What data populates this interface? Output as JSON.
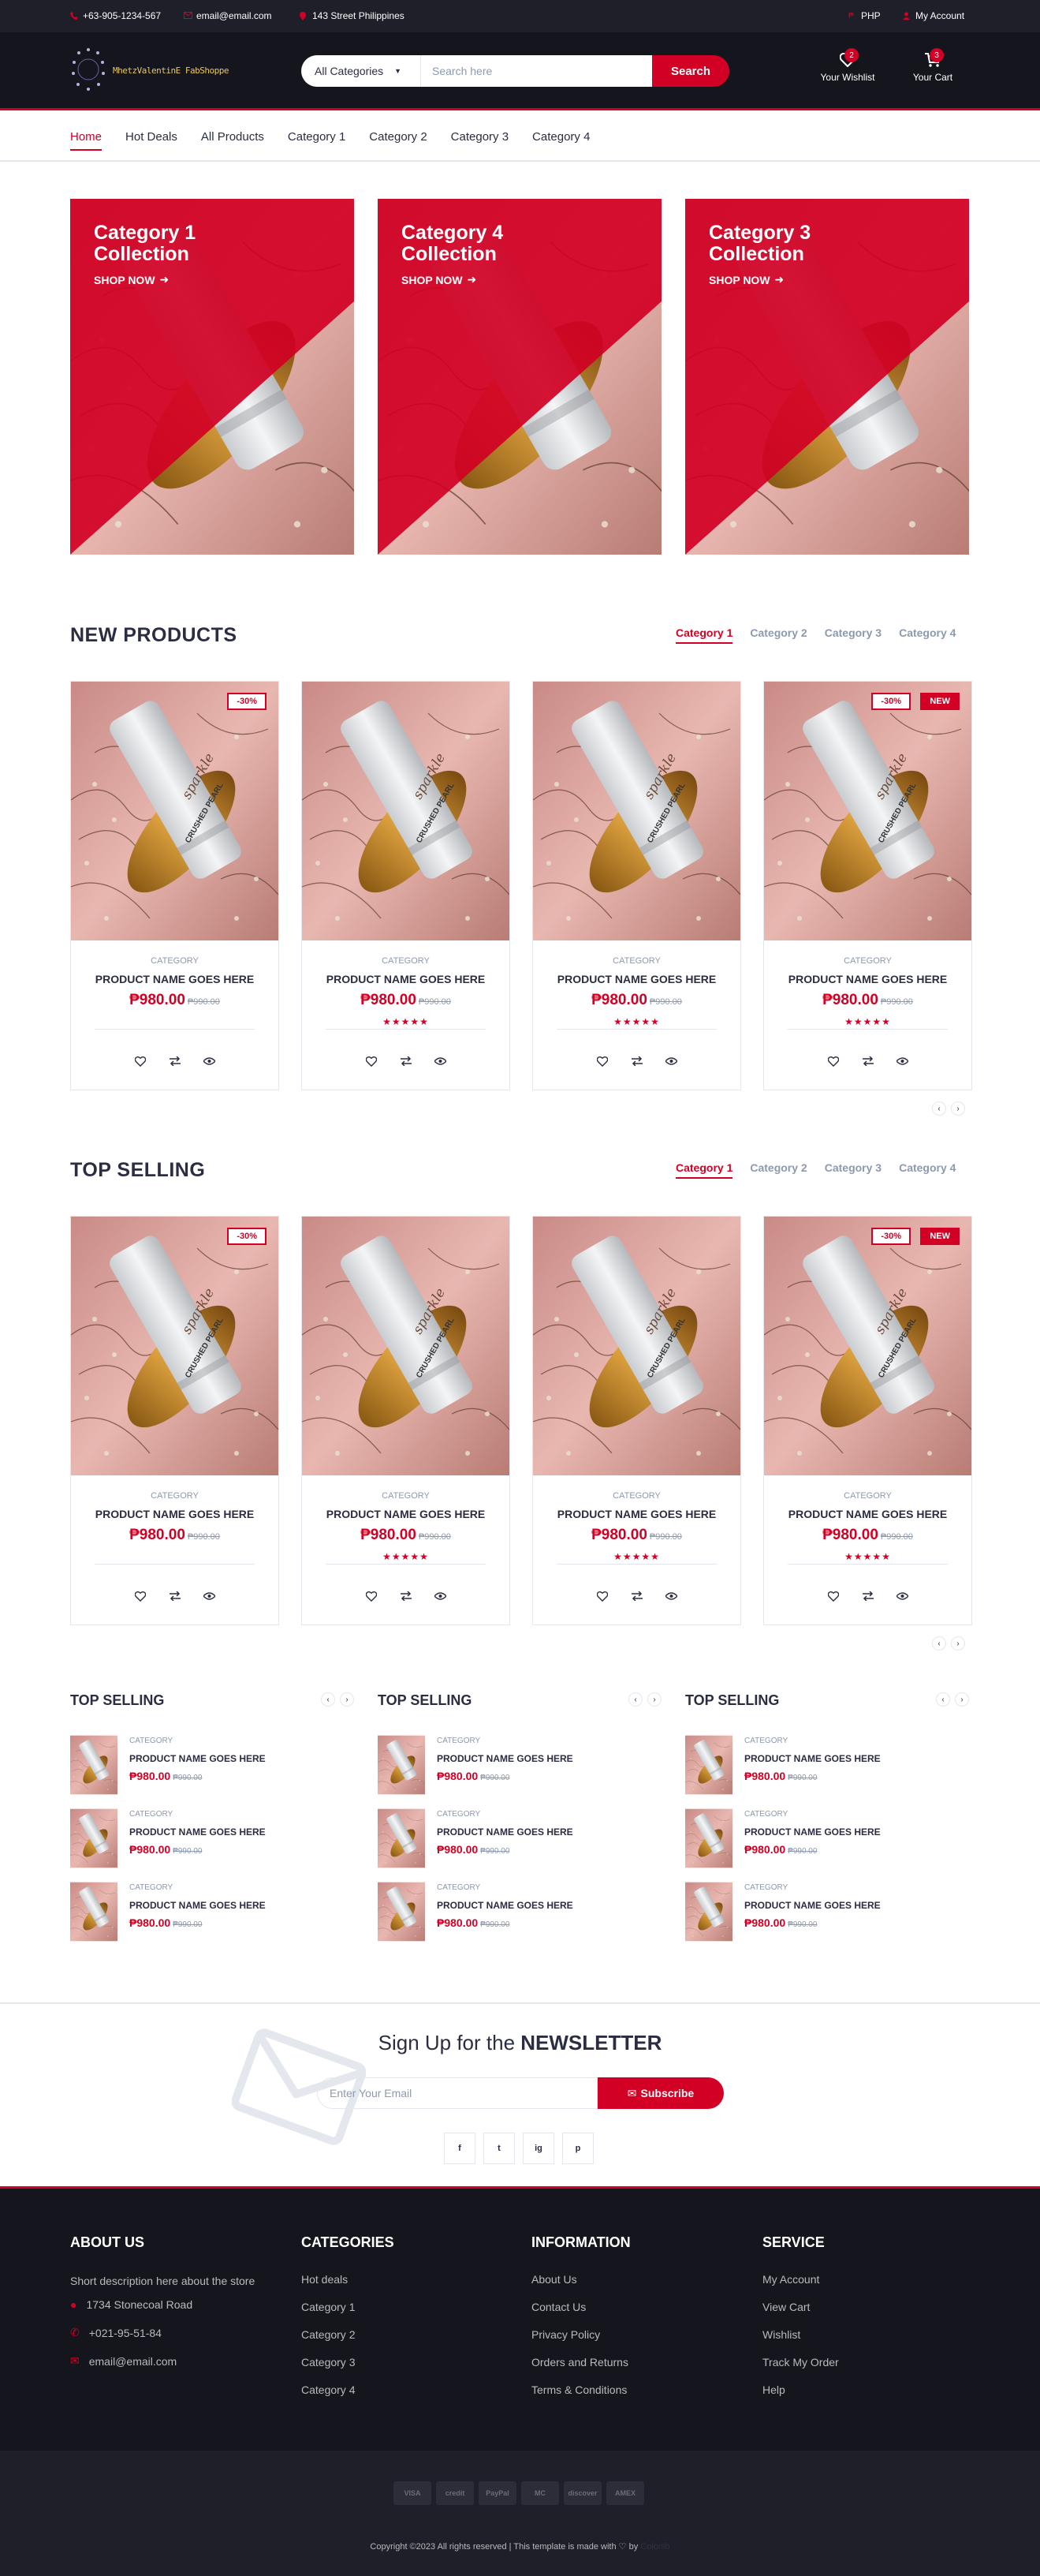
{
  "top_header": {
    "phone": "+63-905-1234-567",
    "email": "email@email.com",
    "address": "143 Street Philippines",
    "currency": "PHP",
    "account": "My Account"
  },
  "header": {
    "logo_text": "MhetzValentinE FabShoppe",
    "category_select": "All Categories",
    "search_placeholder": "Search here",
    "search_button": "Search",
    "wishlist_label": "Your Wishlist",
    "wishlist_qty": "2",
    "cart_label": "Your Cart",
    "cart_qty": "3"
  },
  "nav": [
    "Home",
    "Hot Deals",
    "All Products",
    "Category 1",
    "Category 2",
    "Category 3",
    "Category 4"
  ],
  "shops": [
    {
      "title": "Category 1 Collection",
      "cta": "SHOP NOW"
    },
    {
      "title": "Category 4 Collection",
      "cta": "SHOP NOW"
    },
    {
      "title": "Category 3 Collection",
      "cta": "SHOP NOW"
    }
  ],
  "new_products": {
    "title": "NEW PRODUCTS",
    "tabs": [
      "Category 1",
      "Category 2",
      "Category 3",
      "Category 4"
    ]
  },
  "top_selling": {
    "title": "TOP SELLING",
    "tabs": [
      "Category 1",
      "Category 2",
      "Category 3",
      "Category 4"
    ]
  },
  "product": {
    "category": "CATEGORY",
    "name": "PRODUCT NAME GOES HERE",
    "price": "₱980.00",
    "old_price": "₱990.00",
    "sale_label": "-30%",
    "new_label": "NEW",
    "image_text_a": "CRUSHED PEARL",
    "image_text_b": "sparkle"
  },
  "widgets": {
    "title": "TOP SELLING",
    "category": "CATEGORY",
    "name": "PRODUCT NAME GOES HERE",
    "price": "₱980.00",
    "old_price": "₱990.00"
  },
  "newsletter": {
    "title_pre": "Sign Up for the ",
    "title_strong": "NEWSLETTER",
    "placeholder": "Enter Your Email",
    "button": "Subscribe",
    "social": [
      "f",
      "t",
      "ig",
      "p"
    ]
  },
  "footer": {
    "about_title": "ABOUT US",
    "about_text": "Short description here about the store",
    "address": "1734 Stonecoal Road",
    "phone": "+021-95-51-84",
    "email": "email@email.com",
    "categories_title": "CATEGORIES",
    "categories": [
      "Hot deals",
      "Category 1",
      "Category 2",
      "Category 3",
      "Category 4"
    ],
    "information_title": "INFORMATION",
    "information": [
      "About Us",
      "Contact Us",
      "Privacy Policy",
      "Orders and Returns",
      "Terms & Conditions"
    ],
    "service_title": "SERVICE",
    "service": [
      "My Account",
      "View Cart",
      "Wishlist",
      "Track My Order",
      "Help"
    ]
  },
  "bottom_footer": {
    "payments": [
      "VISA",
      "credit",
      "PayPal",
      "MC",
      "discover",
      "AMEX"
    ],
    "copyright": "Copyright ©2023 All rights reserved | This template is made with ♡ by",
    "credit": "Colorlib"
  },
  "colors": {
    "accent": "#d10024",
    "dark": "#15161d",
    "top": "#1e1f29"
  }
}
